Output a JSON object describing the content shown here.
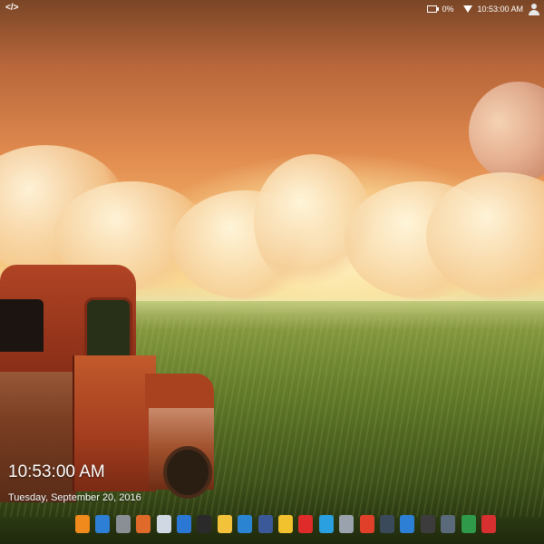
{
  "topbar": {
    "left_icon": "code-icon",
    "battery_percent": "0%",
    "time": "10:53:00 AM",
    "icons": [
      "battery-icon",
      "wifi-icon",
      "user-icon"
    ]
  },
  "clock_widget": {
    "time": "10:53:00 AM",
    "date": "Tuesday, September 20, 2016"
  },
  "dock": {
    "icons": [
      {
        "name": "alarm-clock-icon",
        "color": "#f08a1c"
      },
      {
        "name": "globe-icon",
        "color": "#2d7fd6"
      },
      {
        "name": "calculator-icon",
        "color": "#8a8f96"
      },
      {
        "name": "photo-icon",
        "color": "#e06a2a"
      },
      {
        "name": "document-icon",
        "color": "#cfd8e3"
      },
      {
        "name": "copy-icon",
        "color": "#2b78d4"
      },
      {
        "name": "terminal-icon",
        "color": "#2a2a2a"
      },
      {
        "name": "weather-icon",
        "color": "#f3c23b"
      },
      {
        "name": "shark-icon",
        "color": "#2a84d1"
      },
      {
        "name": "facebook-icon",
        "color": "#3b5998"
      },
      {
        "name": "mail-icon",
        "color": "#f2c12e"
      },
      {
        "name": "youtube-icon",
        "color": "#e02b2b"
      },
      {
        "name": "news-icon",
        "color": "#2aa0e0"
      },
      {
        "name": "archive-icon",
        "color": "#9aa3ad"
      },
      {
        "name": "maps-icon",
        "color": "#e0402a"
      },
      {
        "name": "camera-icon",
        "color": "#3a4a5a"
      },
      {
        "name": "list-icon",
        "color": "#2d7fd6"
      },
      {
        "name": "notes-icon",
        "color": "#3c3c3c"
      },
      {
        "name": "bug-icon",
        "color": "#5a6a7a"
      },
      {
        "name": "shield-icon",
        "color": "#2e9a4a"
      },
      {
        "name": "record-icon",
        "color": "#d83030"
      }
    ]
  }
}
